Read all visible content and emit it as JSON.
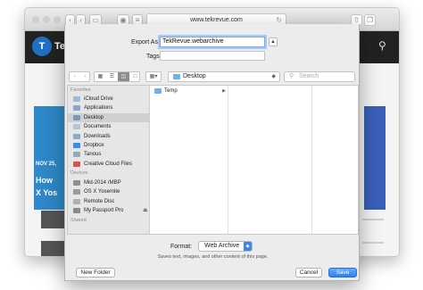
{
  "colors": {
    "accent": "#3d86f0",
    "folder": "#6fb2ea",
    "site_header": "#222222",
    "hero": "#2e88c9"
  },
  "safari": {
    "address": "www.tekrevue.com",
    "site": {
      "logo_mark": "T",
      "logo_text": "Tek",
      "hero_date": "NOV 25,",
      "hero_title_1": "How",
      "hero_title_2": "X Yos"
    }
  },
  "dialog": {
    "export_label": "Export As:",
    "export_value": "TekRevue.webarchive",
    "tags_label": "Tags:",
    "location": "Desktop",
    "search_placeholder": "Search",
    "sidebar": {
      "favorites_header": "Favorites",
      "favorites": [
        {
          "label": "iCloud Drive",
          "icon": "cloud-icon"
        },
        {
          "label": "Applications",
          "icon": "applications-icon"
        },
        {
          "label": "Desktop",
          "icon": "desktop-icon",
          "selected": true
        },
        {
          "label": "Documents",
          "icon": "documents-icon"
        },
        {
          "label": "Downloads",
          "icon": "downloads-icon"
        },
        {
          "label": "Dropbox",
          "icon": "dropbox-icon"
        },
        {
          "label": "Tanous",
          "icon": "home-icon"
        },
        {
          "label": "Creative Cloud Files",
          "icon": "creative-cloud-icon"
        }
      ],
      "devices_header": "Devices",
      "devices": [
        {
          "label": "Mid-2014 rMBP",
          "icon": "laptop-icon"
        },
        {
          "label": "OS X Yosemite",
          "icon": "disk-icon"
        },
        {
          "label": "Remote Disc",
          "icon": "disc-icon"
        },
        {
          "label": "My Passport Pro",
          "icon": "external-drive-icon"
        }
      ],
      "shared_header": "Shared"
    },
    "files": [
      {
        "label": "Temp",
        "icon": "folder-icon"
      }
    ],
    "format_label": "Format:",
    "format_value": "Web Archive",
    "format_description": "Saves text, images, and other content of this page.",
    "new_folder_label": "New Folder",
    "cancel_label": "Cancel",
    "save_label": "Save"
  }
}
